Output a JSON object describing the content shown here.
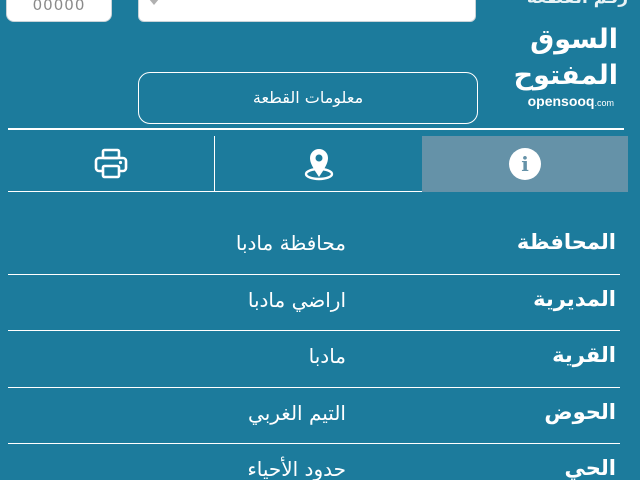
{
  "header": {
    "plot_number_input_value": "00000",
    "plot_number_label": "رقم القطعة",
    "brand_arabic": "السوق المفتوح",
    "brand_english": "opensooq",
    "brand_tld": ".com"
  },
  "parcel_info_button": "معلومات القطعة",
  "tabs": {
    "info_icon": "info-icon",
    "location_icon": "map-pin-icon",
    "print_icon": "printer-icon",
    "active": "info"
  },
  "rows": [
    {
      "label": "المحافظة",
      "value": "محافظة مادبا"
    },
    {
      "label": "المديرية",
      "value": "اراضي مادبا"
    },
    {
      "label": "القرية",
      "value": "مادبا"
    },
    {
      "label": "الحوض",
      "value": "التيم الغربي"
    },
    {
      "label": "الحي",
      "value": "حدود الأحياء"
    }
  ],
  "colors": {
    "background": "#1c7b9c",
    "active_tab": "#6592a8",
    "text": "#ffffff"
  }
}
